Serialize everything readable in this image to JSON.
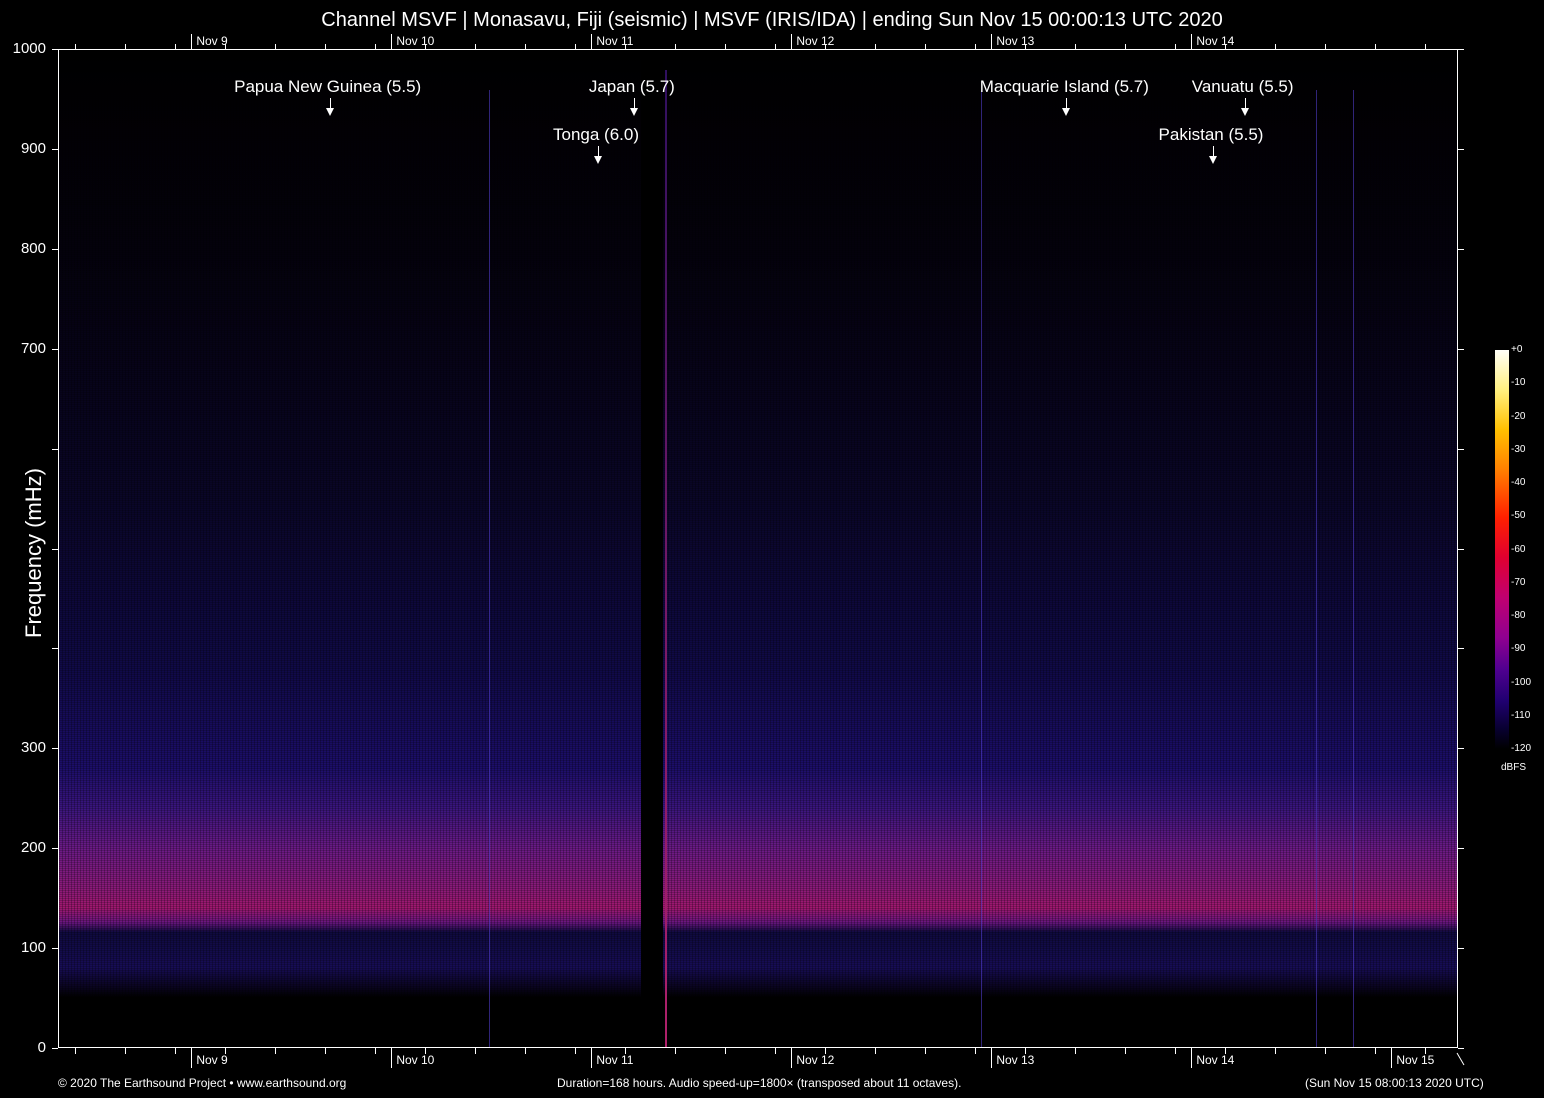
{
  "chart_data": {
    "type": "heatmap",
    "title": "Channel MSVF | Monasavu, Fiji (seismic) | MSVF (IRIS/IDA) | ending Sun Nov 15 00:00:13 UTC 2020",
    "ylabel": "Frequency (mHz)",
    "ylim": [
      0,
      1000
    ],
    "y_ticks": [
      0,
      100,
      200,
      300,
      400,
      500,
      600,
      700,
      800,
      900,
      1000
    ],
    "y_tick_labels": [
      "0",
      "100",
      "200",
      "300",
      "",
      "",
      "",
      "700",
      "800",
      "900",
      "1000"
    ],
    "duration_hours": 168,
    "x_start_hours_before_nov9": 16,
    "x_day_labels": [
      "Nov  9",
      "Nov 10",
      "Nov 11",
      "Nov 12",
      "Nov 13",
      "Nov 14",
      "Nov 15"
    ],
    "top_day_labels": [
      "Nov  9",
      "Nov 10",
      "Nov 11",
      "Nov 12",
      "Nov 13",
      "Nov 14"
    ],
    "events": [
      {
        "label": "Papua New Guinea (5.5)",
        "hours": 32.6,
        "row": 1
      },
      {
        "label": "Japan (5.7)",
        "hours": 69.1,
        "row": 1
      },
      {
        "label": "Tonga (6.0)",
        "hours": 64.8,
        "row": 2
      },
      {
        "label": "Macquarie Island (5.7)",
        "hours": 121.0,
        "row": 1
      },
      {
        "label": "Vanuatu (5.5)",
        "hours": 142.4,
        "row": 1
      },
      {
        "label": "Pakistan (5.5)",
        "hours": 138.6,
        "row": 2
      }
    ],
    "colorbar": {
      "unit": "dBFS",
      "ticks": [
        "+0",
        "-10",
        "-20",
        "-30",
        "-40",
        "-50",
        "-60",
        "-70",
        "-80",
        "-90",
        "-100",
        "-110",
        "-120"
      ],
      "range": [
        -120,
        0
      ]
    }
  },
  "footer": {
    "left": "© 2020 The Earthsound Project • www.earthsound.org",
    "center": "Duration=168 hours. Audio speed-up=1800× (transposed about 11 octaves).",
    "right": "(Sun Nov 15 08:00:13 2020 UTC)"
  }
}
